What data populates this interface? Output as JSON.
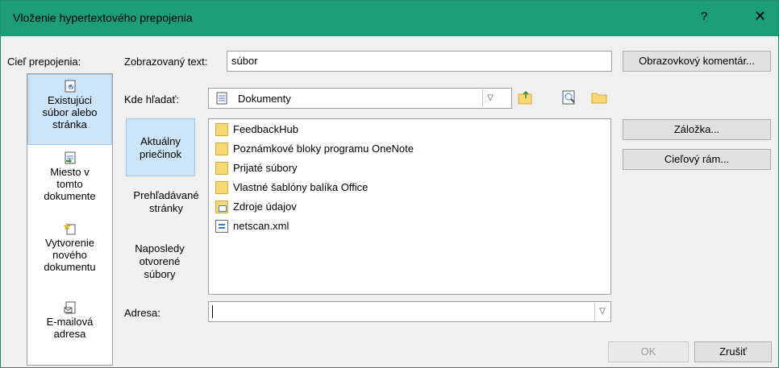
{
  "window": {
    "title": "Vloženie hypertextového prepojenia",
    "help": "?",
    "close": "✕"
  },
  "link_to": {
    "label": "Cieľ prepojenia:",
    "items": [
      {
        "label_lines": [
          "Existujúci",
          "súbor alebo",
          "stránka"
        ],
        "icon": "existing-file-icon",
        "selected": true
      },
      {
        "label_lines": [
          "Miesto v",
          "tomto",
          "dokumente"
        ],
        "icon": "place-in-document-icon",
        "selected": false
      },
      {
        "label_lines": [
          "Vytvorenie",
          "nového",
          "dokumentu"
        ],
        "icon": "new-document-icon",
        "selected": false
      },
      {
        "label_lines": [
          "E-mailová",
          "adresa"
        ],
        "icon": "email-address-icon",
        "selected": false
      }
    ]
  },
  "display_text": {
    "label": "Zobrazovaný text:",
    "value": "súbor"
  },
  "screentip_button": "Obrazovkový komentár...",
  "look_in": {
    "label": "Kde hľadať:",
    "value": "Dokumenty",
    "icon": "documents-folder-icon"
  },
  "toolbar_icons": [
    "up-one-folder-icon",
    "browse-web-icon",
    "browse-file-icon"
  ],
  "side_nav": {
    "items": [
      {
        "label_lines": [
          "Aktuálny",
          "priečinok"
        ],
        "selected": true
      },
      {
        "label_lines": [
          "Prehľadávané",
          "stránky"
        ],
        "selected": false
      },
      {
        "label_lines": [
          "Naposledy",
          "otvorené",
          "súbory"
        ],
        "selected": false
      }
    ]
  },
  "files": [
    {
      "name": "FeedbackHub",
      "icon": "folder-icon"
    },
    {
      "name": "Poznámkové bloky programu OneNote",
      "icon": "folder-icon"
    },
    {
      "name": "Prijaté súbory",
      "icon": "folder-icon"
    },
    {
      "name": "Vlastné šablóny balíka Office",
      "icon": "folder-icon"
    },
    {
      "name": "Zdroje údajov",
      "icon": "data-source-folder-icon"
    },
    {
      "name": "netscan.xml",
      "icon": "xml-file-icon"
    }
  ],
  "bookmark_button": "Záložka...",
  "target_frame_button": "Cieľový rám...",
  "address": {
    "label": "Adresa:",
    "value": ""
  },
  "ok_button": "OK",
  "cancel_button": "Zrušiť",
  "colors": {
    "titlebar": "#1b9e75",
    "selection": "#cce4f7",
    "dialog_bg": "#f0f0f0"
  }
}
